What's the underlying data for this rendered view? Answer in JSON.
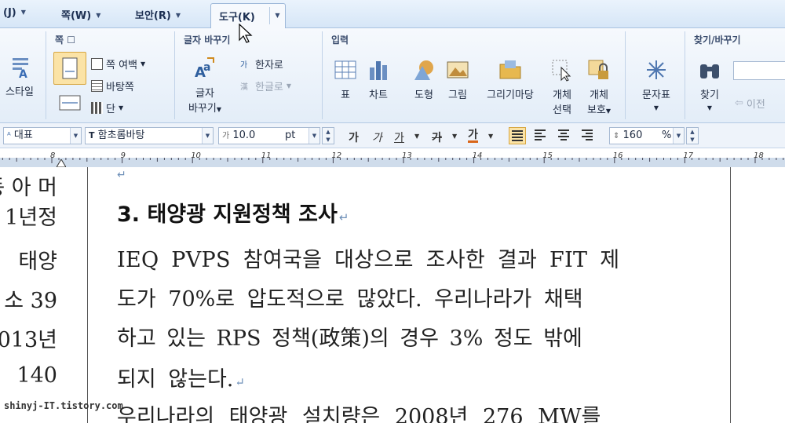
{
  "menu": {
    "tab_j": "(J)",
    "tab_page": "쪽(W)",
    "tab_security": "보안(R)",
    "tab_tools": "도구(K)"
  },
  "ribbon": {
    "style_label": "스타일",
    "group_page": "쪽",
    "page_margin": "쪽 여백",
    "page_bg": "바탕쪽",
    "column": "단",
    "group_char_convert": "글자 바꾸기",
    "char_convert_line1": "글자",
    "char_convert_line2": "바꾸기",
    "to_hanja": "한자로",
    "to_hangul": "한글로",
    "group_input": "입력",
    "table": "표",
    "chart": "차트",
    "shape": "도형",
    "picture": "그림",
    "grimaru": "그리기마당",
    "object_select_1": "개체",
    "object_select_2": "선택",
    "object_protect_1": "개체",
    "object_protect_2": "보호",
    "char_table": "문자표",
    "group_find": "찾기/바꾸기",
    "find": "찾기",
    "prev": "이전"
  },
  "format": {
    "style_value": "대표",
    "font_value": "함초롬바탕",
    "size_value": "10.0",
    "size_unit": "pt",
    "bold": "가",
    "italic": "가",
    "underline": "가",
    "strike": "가",
    "color": "가",
    "line_spacing": "160",
    "line_unit": "%"
  },
  "ruler": {
    "marks": [
      "8",
      "9",
      "10",
      "11",
      "12",
      "13",
      "14",
      "15",
      "16",
      "17",
      "18"
    ]
  },
  "document": {
    "left_page_lines": [
      "동 아 머",
      "1년정",
      "태양",
      "소 39",
      "013년",
      "140"
    ],
    "heading": "3. 태양광 지원정책 조사",
    "paragraph_lines": [
      "IEQ PVPS 참여국을 대상으로 조사한 결과 FIT 제",
      "도가 70%로 압도적으로 많았다. 우리나라가 채택",
      "하고 있는 RPS 정책(政策)의 경우 3% 정도 밖에",
      "되지 않는다.",
      "우리나라의 태양광 설치량은 2008년 276 MW를"
    ]
  },
  "watermark": "shinyj-IT.tistory.com",
  "colors": {
    "ribbon_bg": "#e3edf8",
    "active_align": "#fbe3a6",
    "return_mark": "#6d8fb8"
  }
}
